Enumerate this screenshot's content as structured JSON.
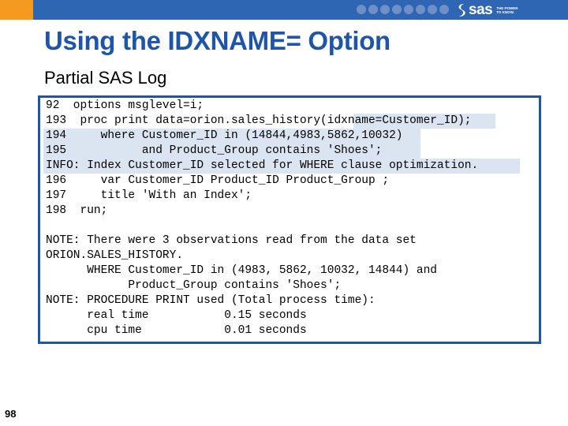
{
  "header": {
    "brand_color": "#2f66b3",
    "accent_color": "#f49a1e",
    "logo_text": "sas",
    "logo_tagline": "THE POWER TO KNOW."
  },
  "slide": {
    "title": "Using the IDXNAME= Option",
    "subtitle": "Partial SAS Log",
    "number": "98"
  },
  "log": {
    "lines": [
      "92  options msglevel=i;",
      "193  proc print data=orion.sales_history(idxname=Customer_ID);",
      "194     where Customer_ID in (14844,4983,5862,10032)",
      "195           and Product_Group contains 'Shoes';",
      "INFO: Index Customer_ID selected for WHERE clause optimization.",
      "196     var Customer_ID Product_ID Product_Group ;",
      "197     title 'With an Index';",
      "198  run;",
      "",
      "NOTE: There were 3 observations read from the data set",
      "ORION.SALES_HISTORY.",
      "      WHERE Customer_ID in (4983, 5862, 10032, 14844) and",
      "            Product_Group contains 'Shoes';",
      "NOTE: PROCEDURE PRINT used (Total process time):",
      "      real time           0.15 seconds",
      "      cpu time            0.01 seconds"
    ],
    "highlight_color": "#dbe5f1",
    "border_color": "#1f55a8"
  }
}
